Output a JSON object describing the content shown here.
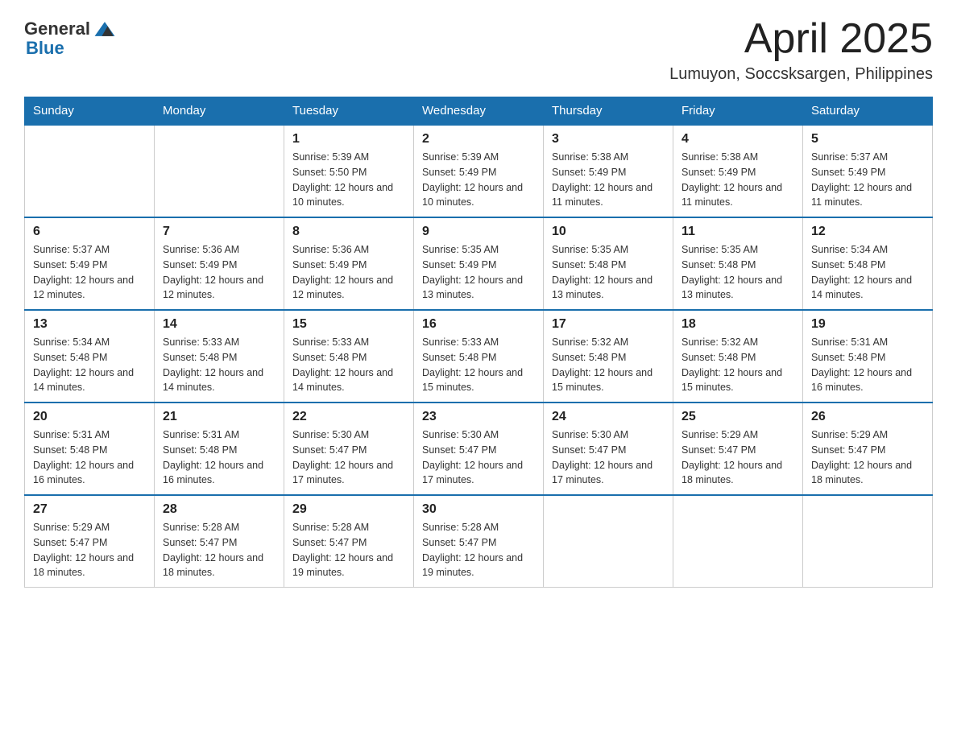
{
  "logo": {
    "general": "General",
    "blue": "Blue"
  },
  "header": {
    "title": "April 2025",
    "subtitle": "Lumuyon, Soccsksargen, Philippines"
  },
  "weekdays": [
    "Sunday",
    "Monday",
    "Tuesday",
    "Wednesday",
    "Thursday",
    "Friday",
    "Saturday"
  ],
  "weeks": [
    [
      {
        "day": "",
        "sunrise": "",
        "sunset": "",
        "daylight": ""
      },
      {
        "day": "",
        "sunrise": "",
        "sunset": "",
        "daylight": ""
      },
      {
        "day": "1",
        "sunrise": "Sunrise: 5:39 AM",
        "sunset": "Sunset: 5:50 PM",
        "daylight": "Daylight: 12 hours and 10 minutes."
      },
      {
        "day": "2",
        "sunrise": "Sunrise: 5:39 AM",
        "sunset": "Sunset: 5:49 PM",
        "daylight": "Daylight: 12 hours and 10 minutes."
      },
      {
        "day": "3",
        "sunrise": "Sunrise: 5:38 AM",
        "sunset": "Sunset: 5:49 PM",
        "daylight": "Daylight: 12 hours and 11 minutes."
      },
      {
        "day": "4",
        "sunrise": "Sunrise: 5:38 AM",
        "sunset": "Sunset: 5:49 PM",
        "daylight": "Daylight: 12 hours and 11 minutes."
      },
      {
        "day": "5",
        "sunrise": "Sunrise: 5:37 AM",
        "sunset": "Sunset: 5:49 PM",
        "daylight": "Daylight: 12 hours and 11 minutes."
      }
    ],
    [
      {
        "day": "6",
        "sunrise": "Sunrise: 5:37 AM",
        "sunset": "Sunset: 5:49 PM",
        "daylight": "Daylight: 12 hours and 12 minutes."
      },
      {
        "day": "7",
        "sunrise": "Sunrise: 5:36 AM",
        "sunset": "Sunset: 5:49 PM",
        "daylight": "Daylight: 12 hours and 12 minutes."
      },
      {
        "day": "8",
        "sunrise": "Sunrise: 5:36 AM",
        "sunset": "Sunset: 5:49 PM",
        "daylight": "Daylight: 12 hours and 12 minutes."
      },
      {
        "day": "9",
        "sunrise": "Sunrise: 5:35 AM",
        "sunset": "Sunset: 5:49 PM",
        "daylight": "Daylight: 12 hours and 13 minutes."
      },
      {
        "day": "10",
        "sunrise": "Sunrise: 5:35 AM",
        "sunset": "Sunset: 5:48 PM",
        "daylight": "Daylight: 12 hours and 13 minutes."
      },
      {
        "day": "11",
        "sunrise": "Sunrise: 5:35 AM",
        "sunset": "Sunset: 5:48 PM",
        "daylight": "Daylight: 12 hours and 13 minutes."
      },
      {
        "day": "12",
        "sunrise": "Sunrise: 5:34 AM",
        "sunset": "Sunset: 5:48 PM",
        "daylight": "Daylight: 12 hours and 14 minutes."
      }
    ],
    [
      {
        "day": "13",
        "sunrise": "Sunrise: 5:34 AM",
        "sunset": "Sunset: 5:48 PM",
        "daylight": "Daylight: 12 hours and 14 minutes."
      },
      {
        "day": "14",
        "sunrise": "Sunrise: 5:33 AM",
        "sunset": "Sunset: 5:48 PM",
        "daylight": "Daylight: 12 hours and 14 minutes."
      },
      {
        "day": "15",
        "sunrise": "Sunrise: 5:33 AM",
        "sunset": "Sunset: 5:48 PM",
        "daylight": "Daylight: 12 hours and 14 minutes."
      },
      {
        "day": "16",
        "sunrise": "Sunrise: 5:33 AM",
        "sunset": "Sunset: 5:48 PM",
        "daylight": "Daylight: 12 hours and 15 minutes."
      },
      {
        "day": "17",
        "sunrise": "Sunrise: 5:32 AM",
        "sunset": "Sunset: 5:48 PM",
        "daylight": "Daylight: 12 hours and 15 minutes."
      },
      {
        "day": "18",
        "sunrise": "Sunrise: 5:32 AM",
        "sunset": "Sunset: 5:48 PM",
        "daylight": "Daylight: 12 hours and 15 minutes."
      },
      {
        "day": "19",
        "sunrise": "Sunrise: 5:31 AM",
        "sunset": "Sunset: 5:48 PM",
        "daylight": "Daylight: 12 hours and 16 minutes."
      }
    ],
    [
      {
        "day": "20",
        "sunrise": "Sunrise: 5:31 AM",
        "sunset": "Sunset: 5:48 PM",
        "daylight": "Daylight: 12 hours and 16 minutes."
      },
      {
        "day": "21",
        "sunrise": "Sunrise: 5:31 AM",
        "sunset": "Sunset: 5:48 PM",
        "daylight": "Daylight: 12 hours and 16 minutes."
      },
      {
        "day": "22",
        "sunrise": "Sunrise: 5:30 AM",
        "sunset": "Sunset: 5:47 PM",
        "daylight": "Daylight: 12 hours and 17 minutes."
      },
      {
        "day": "23",
        "sunrise": "Sunrise: 5:30 AM",
        "sunset": "Sunset: 5:47 PM",
        "daylight": "Daylight: 12 hours and 17 minutes."
      },
      {
        "day": "24",
        "sunrise": "Sunrise: 5:30 AM",
        "sunset": "Sunset: 5:47 PM",
        "daylight": "Daylight: 12 hours and 17 minutes."
      },
      {
        "day": "25",
        "sunrise": "Sunrise: 5:29 AM",
        "sunset": "Sunset: 5:47 PM",
        "daylight": "Daylight: 12 hours and 18 minutes."
      },
      {
        "day": "26",
        "sunrise": "Sunrise: 5:29 AM",
        "sunset": "Sunset: 5:47 PM",
        "daylight": "Daylight: 12 hours and 18 minutes."
      }
    ],
    [
      {
        "day": "27",
        "sunrise": "Sunrise: 5:29 AM",
        "sunset": "Sunset: 5:47 PM",
        "daylight": "Daylight: 12 hours and 18 minutes."
      },
      {
        "day": "28",
        "sunrise": "Sunrise: 5:28 AM",
        "sunset": "Sunset: 5:47 PM",
        "daylight": "Daylight: 12 hours and 18 minutes."
      },
      {
        "day": "29",
        "sunrise": "Sunrise: 5:28 AM",
        "sunset": "Sunset: 5:47 PM",
        "daylight": "Daylight: 12 hours and 19 minutes."
      },
      {
        "day": "30",
        "sunrise": "Sunrise: 5:28 AM",
        "sunset": "Sunset: 5:47 PM",
        "daylight": "Daylight: 12 hours and 19 minutes."
      },
      {
        "day": "",
        "sunrise": "",
        "sunset": "",
        "daylight": ""
      },
      {
        "day": "",
        "sunrise": "",
        "sunset": "",
        "daylight": ""
      },
      {
        "day": "",
        "sunrise": "",
        "sunset": "",
        "daylight": ""
      }
    ]
  ]
}
